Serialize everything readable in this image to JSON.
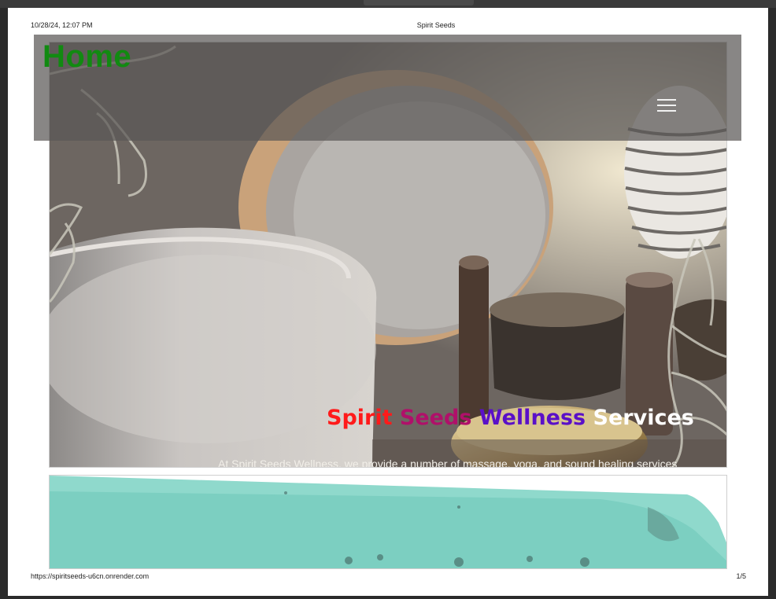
{
  "print_header": {
    "datetime": "10/28/24, 12:07 PM",
    "title": "Spirit Seeds"
  },
  "navbar": {
    "brand": "Home",
    "menu_icon": "hamburger-menu-icon"
  },
  "hero": {
    "title_parts": [
      "Spirit",
      "Seeds",
      "Wellness",
      "Services"
    ],
    "title_colors": [
      "#ff1a1a",
      "#b0106a",
      "#5a10c8",
      "#ffffff"
    ],
    "subtitle": "At Spirit Seeds Wellness, we provide a number of massage, yoga, and sound healing services"
  },
  "print_footer": {
    "url": "https://spiritseeds-u6cn.onrender.com",
    "page": "1/5"
  },
  "colors": {
    "brand_green": "#118a11",
    "navbar_overlay": "#5a5856",
    "teal_section": "#7fd6c8"
  }
}
